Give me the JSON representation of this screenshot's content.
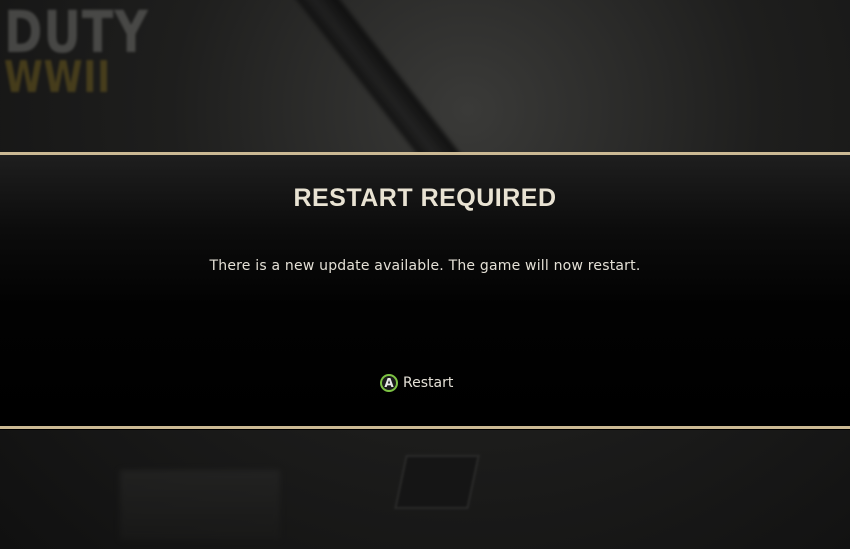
{
  "background": {
    "logo_line1": "DUTY",
    "logo_line2": "WWII"
  },
  "dialog": {
    "title": "RESTART REQUIRED",
    "message": "There is a new update available. The game will now restart.",
    "action": {
      "button_glyph": "A",
      "button_icon": "a-button-icon",
      "label": "Restart"
    }
  },
  "colors": {
    "accent_line": "#cbb994",
    "a_button_ring": "#7cc243",
    "text": "#e4e0d6"
  }
}
